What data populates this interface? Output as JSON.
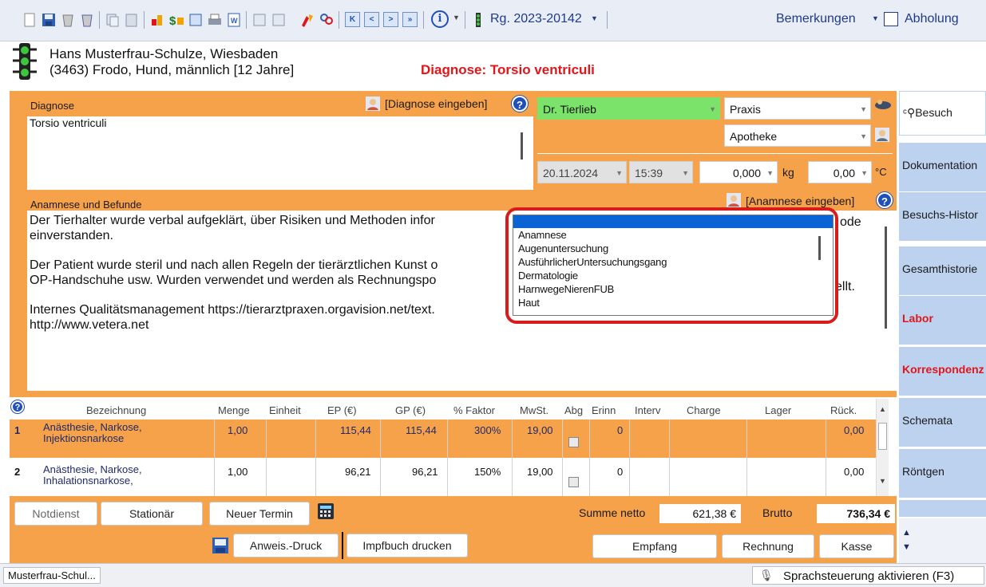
{
  "toolbar": {
    "invoice_number": "Rg. 2023-20142",
    "remarks_label": "Bemerkungen",
    "pickup_label": "Abholung",
    "nav_first": "K",
    "nav_prev": "<",
    "nav_next": ">",
    "nav_last": "»",
    "info_symbol": "i"
  },
  "patient": {
    "owner_line": "Hans Musterfrau-Schulze, Wiesbaden",
    "animal_line": "(3463) Frodo, Hund, männlich [12 Jahre]",
    "diagnosis_banner": "Diagnose: Torsio ventriculi"
  },
  "diagnosis": {
    "label": "Diagnose",
    "enter_link": "[Diagnose eingeben]",
    "text": "Torsio ventriculi"
  },
  "visit": {
    "doctor": "Dr. Tierlieb",
    "location": "Praxis",
    "pharmacy": "Apotheke",
    "date": "20.11.2024",
    "time": "15:39",
    "weight": "0,000",
    "weight_unit": "kg",
    "temperature": "0,00",
    "temperature_unit": "°C"
  },
  "anamnesis": {
    "label": "Anamnese und Befunde",
    "enter_link": "[Anamnese eingeben]",
    "lines": [
      "Der Tierhalter wurde verbal aufgeklärt, über Risiken und Methoden infor",
      "einverstanden.",
      "Der Patient wurde steril und nach allen Regeln der tierärztlichen Kunst o",
      "OP-Handschuhe usw. Wurden verwendet und werden als Rechnungspo",
      "Internes Qualitätsmanagement https://tierarztpraxen.orgavision.net/text.",
      "http://www.vetera.net"
    ],
    "tail_line1": "ode",
    "tail_line4": "ellt."
  },
  "template_dropdown": {
    "items": [
      "Anamnese",
      "Augenuntersuchung",
      "AusführlicherUntersuchungsgang",
      "Dermatologie",
      "HarnwegeNierenFUB",
      "Haut"
    ]
  },
  "table": {
    "help": "?",
    "headers": [
      "Bezeichnung",
      "Menge",
      "Einheit",
      "EP (€)",
      "GP (€)",
      "% Faktor",
      "MwSt.",
      "Abg",
      "Erinn",
      "Interv",
      "Charge",
      "Lager",
      "Rück."
    ],
    "rows": [
      {
        "nr": "1",
        "name1": "Anästhesie, Narkose,",
        "name2": "Injektionsnarkose",
        "menge": "1,00",
        "ep": "115,44",
        "gp": "115,44",
        "faktor": "300%",
        "mwst": "19,00",
        "erinn": "0",
        "rueck": "0,00"
      },
      {
        "nr": "2",
        "name1": "Anästhesie, Narkose,",
        "name2": "Inhalationsnarkose,",
        "menge": "1,00",
        "ep": "96,21",
        "gp": "96,21",
        "faktor": "150%",
        "mwst": "19,00",
        "erinn": "0",
        "rueck": "0,00"
      }
    ]
  },
  "buttons": {
    "notdienst": "Notdienst",
    "stationaer": "Stationär",
    "neuer_termin": "Neuer Termin",
    "anweis_druck": "Anweis.-Druck",
    "impfbuch": "Impfbuch drucken",
    "empfang": "Empfang",
    "rechnung": "Rechnung",
    "kasse": "Kasse"
  },
  "totals": {
    "netto_label": "Summe netto",
    "netto": "621,38 €",
    "brutto_label": "Brutto",
    "brutto": "736,34 €"
  },
  "tabs": {
    "besuch": "Besuch",
    "dokumentation": "Dokumentation",
    "historie": "Besuchs-Histor",
    "gesamt": "Gesamthistorie",
    "labor": "Labor",
    "korrespondenz": "Korrespondenz",
    "schemata": "Schemata",
    "roentgen": "Röntgen"
  },
  "status": {
    "patient": "Musterfrau-Schul...",
    "voice": "Sprachsteuerung aktivieren (F3)"
  },
  "colors": {
    "panel_orange": "#f6a24a",
    "tab_blue": "#bcd2ef",
    "highlight_blue": "#0a64d6",
    "alert_red": "#e0161b",
    "doctor_green": "#7be36a"
  }
}
